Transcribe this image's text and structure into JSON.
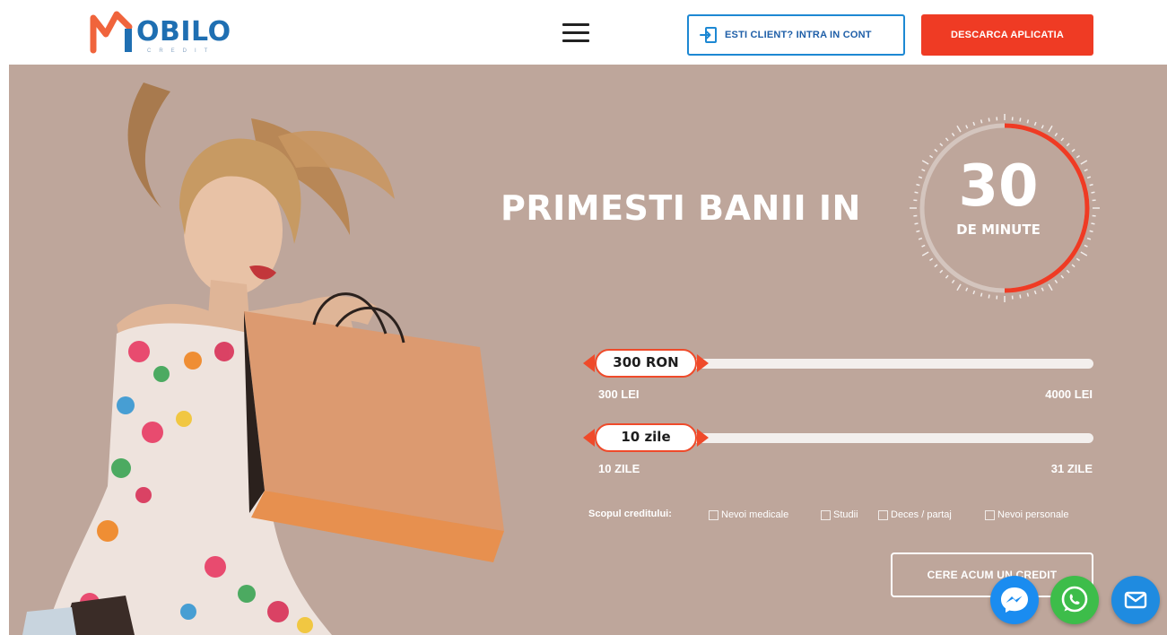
{
  "header": {
    "logo_text": "OBILO",
    "logo_subtext": "CREDIT",
    "login_button": "ESTI CLIENT? INTRA IN CONT",
    "download_button": "DESCARCA APLICATIA"
  },
  "hero": {
    "headline": "PRIMESTI BANII IN",
    "timer_number": "30",
    "timer_label": "DE MINUTE"
  },
  "amount_slider": {
    "value_label": "300 RON",
    "min_label": "300 LEI",
    "max_label": "4000 LEI",
    "min": 300,
    "max": 4000,
    "value": 300
  },
  "days_slider": {
    "value_label": "10 zile",
    "min_label": "10 ZILE",
    "max_label": "31 ZILE",
    "min": 10,
    "max": 31,
    "value": 10
  },
  "purpose": {
    "label": "Scopul creditului:",
    "options": [
      "Nevoi medicale",
      "Studii",
      "Deces / partaj",
      "Nevoi personale"
    ]
  },
  "cta_button": "CERE ACUM UN CREDIT",
  "colors": {
    "brand_blue": "#1f6fb2",
    "accent_orange": "#ef3b24",
    "hero_background": "#bea69b",
    "messenger": "#1a8cf0",
    "whatsapp": "#3dbd4a",
    "email": "#1f8be0"
  },
  "floating_actions": [
    "messenger-icon",
    "whatsapp-icon",
    "email-icon"
  ]
}
